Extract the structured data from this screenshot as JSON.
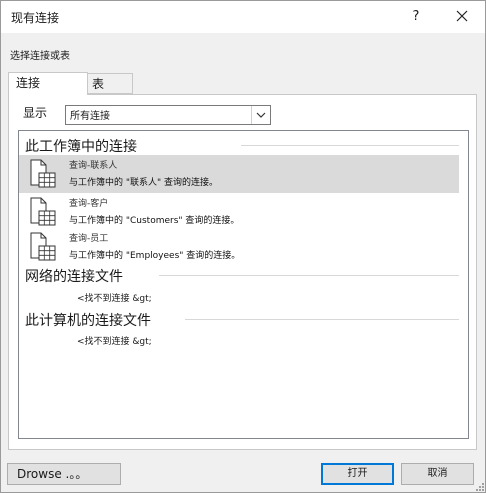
{
  "window": {
    "title": "现有连接",
    "help_glyph": "?"
  },
  "section_label": "选择连接或表",
  "tabs": [
    {
      "label": "连接",
      "active": true
    },
    {
      "label": "表",
      "active": false
    }
  ],
  "show": {
    "label": "显示",
    "selected": "所有连接"
  },
  "groups": {
    "workbook": {
      "header": "此工作簿中的连接",
      "items": [
        {
          "name": "查询-联系人",
          "description": "与工作簿中的 \"联系人\" 查询的连接。",
          "selected": true
        },
        {
          "name": "查询-客户",
          "description": "与工作簿中的 \"Customers\" 查询的连接。",
          "selected": false
        },
        {
          "name": "查询-员工",
          "description": "与工作簿中的 \"Employees\" 查询的连接。",
          "selected": false
        }
      ]
    },
    "network": {
      "header": "网络的连接文件",
      "empty_text": "<找不到连接 &gt;"
    },
    "computer": {
      "header": "此计算机的连接文件",
      "empty_text": "<找不到连接 &gt;"
    }
  },
  "buttons": {
    "browse": "Drowse .。。",
    "open": "打开",
    "cancel": "取消"
  },
  "icons": {
    "close": "close-icon",
    "dropdown": "chevron-down-icon",
    "connection": "table-document-icon",
    "grip": "resize-grip-icon"
  }
}
